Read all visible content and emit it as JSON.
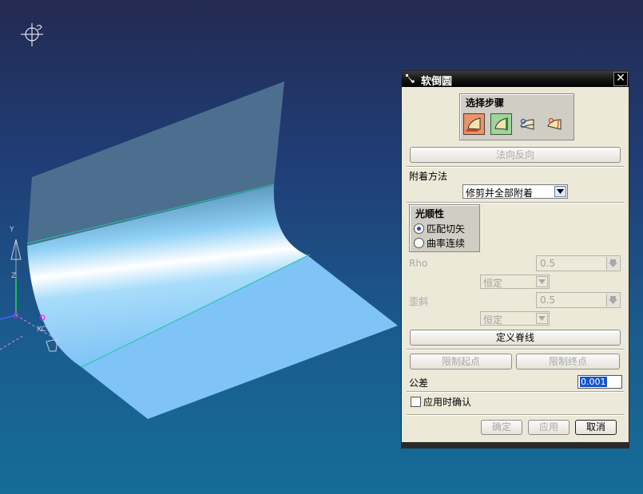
{
  "dialog": {
    "title": "软倒圆",
    "close_glyph": "✕",
    "steps_group_title": "选择步骤",
    "flip_normal_button": "法向反向",
    "attach_method_label": "附着方法",
    "attach_method_value": "修剪并全部附着",
    "smoothness_group_title": "光顺性",
    "smoothness_options": [
      {
        "label": "匹配切矢",
        "selected": true
      },
      {
        "label": "曲率连续",
        "selected": false
      }
    ],
    "rho_label": "Rho",
    "rho_value": "0.5",
    "rho_mode": "恒定",
    "skew_label": "歪斜",
    "skew_value": "0.5",
    "skew_mode": "恒定",
    "define_spine_button": "定义脊线",
    "limit_start_button": "限制起点",
    "limit_end_button": "限制终点",
    "tolerance_label": "公差",
    "tolerance_value": "0.001",
    "confirm_on_apply_label": "应用时确认",
    "confirm_on_apply_checked": false,
    "ok_button": "确定",
    "apply_button": "应用",
    "cancel_button": "取消"
  },
  "viewport": {
    "axis_labels": [
      "Y",
      "X",
      "Z",
      "XC"
    ]
  },
  "colors": {
    "background_top": "#232a52",
    "background_bottom": "#156c97",
    "surface": "#7fc3f7",
    "edge_line": "#18c8a0"
  }
}
